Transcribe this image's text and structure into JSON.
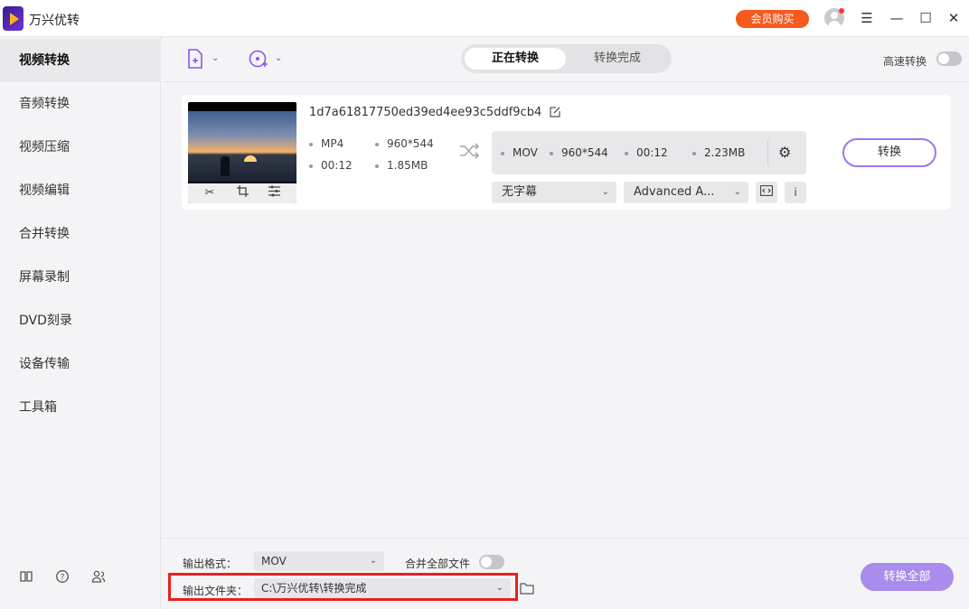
{
  "app": {
    "title": "万兴优转",
    "vip_label": "会员购买"
  },
  "window_controls": [
    "☰",
    "—",
    "☐",
    "✕"
  ],
  "sidebar": {
    "items": [
      {
        "label": "视频转换",
        "active": true
      },
      {
        "label": "音频转换"
      },
      {
        "label": "视频压缩"
      },
      {
        "label": "视频编辑"
      },
      {
        "label": "合并转换"
      },
      {
        "label": "屏幕录制"
      },
      {
        "label": "DVD刻录"
      },
      {
        "label": "设备传输"
      },
      {
        "label": "工具箱"
      }
    ],
    "bottom_icons": [
      "book-icon",
      "help-icon",
      "user-group-icon"
    ]
  },
  "toolbar": {
    "tabs": [
      {
        "label": "正在转换",
        "active": true
      },
      {
        "label": "转换完成"
      }
    ],
    "speed_label": "高速转换",
    "speed_enabled": false
  },
  "file": {
    "name": "1d7a61817750ed39ed4ee93c5ddf9cb4",
    "source": {
      "format": "MP4",
      "resolution": "960*544",
      "duration": "00:12",
      "size": "1.85MB"
    },
    "target": {
      "format": "MOV",
      "resolution": "960*544",
      "duration": "00:12",
      "size": "2.23MB"
    },
    "subtitle": "无字幕",
    "audio": "Advanced A...",
    "convert_label": "转换"
  },
  "footer": {
    "format_label": "输出格式：",
    "format_value": "MOV",
    "merge_label": "合并全部文件",
    "merge_enabled": false,
    "folder_label": "输出文件夹：",
    "folder_value": "C:\\万兴优转\\转换完成",
    "convert_all_label": "转换全部"
  },
  "colors": {
    "accent": "#8a56e8",
    "vip": "#f55a1e",
    "highlight": "#e8201d",
    "convert_all": "#a98ceb"
  }
}
